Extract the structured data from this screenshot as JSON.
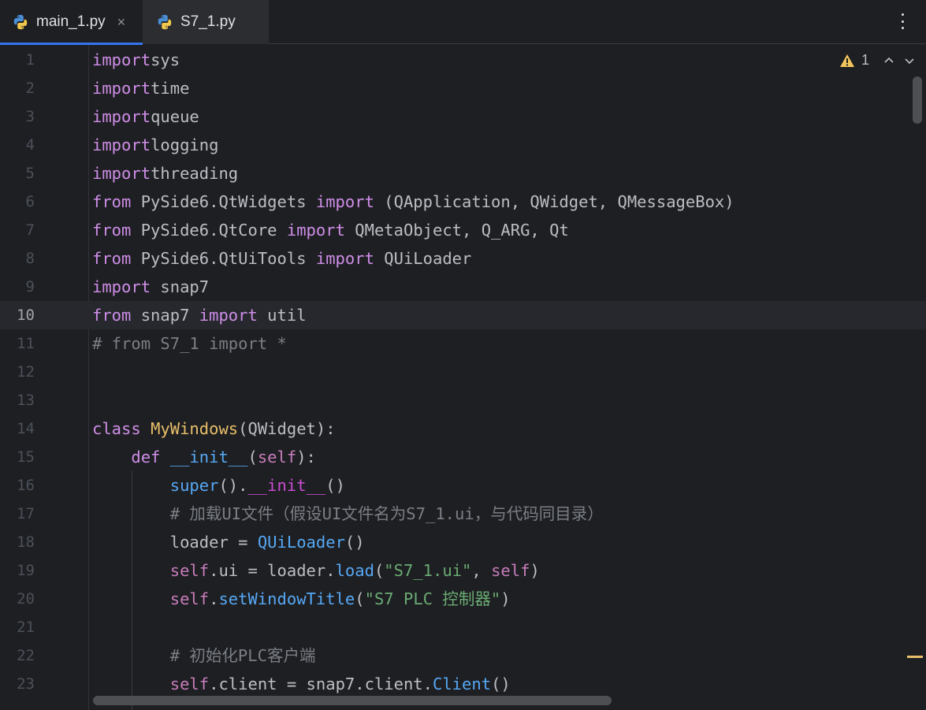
{
  "tabs": [
    {
      "label": "main_1.py",
      "icon": "python-icon",
      "active": true,
      "close": "×"
    },
    {
      "label": "S7_1.py",
      "icon": "python-icon",
      "active": false
    }
  ],
  "inspection": {
    "warnings": "1"
  },
  "current_line": 10,
  "colors": {
    "background": "#1e1f22",
    "keyword": "#cf8ee8",
    "class_name": "#e8bf6a",
    "function": "#56a8f5",
    "string": "#6aab73",
    "comment": "#7a7e85",
    "tab_accent": "#3574f0"
  },
  "code_lines": [
    [
      [
        "kw",
        "import"
      ],
      [
        "",
        "sys"
      ]
    ],
    [
      [
        "kw",
        "import"
      ],
      [
        "",
        "time"
      ]
    ],
    [
      [
        "kw",
        "import"
      ],
      [
        "",
        "queue"
      ]
    ],
    [
      [
        "kw",
        "import"
      ],
      [
        "",
        "logging"
      ]
    ],
    [
      [
        "kw",
        "import"
      ],
      [
        "",
        "threading"
      ]
    ],
    [
      [
        "kw",
        "from"
      ],
      [
        "",
        " PySide6.QtWidgets "
      ],
      [
        "kw",
        "import"
      ],
      [
        "",
        " (QApplication, QWidget, QMessageBox)"
      ]
    ],
    [
      [
        "kw",
        "from"
      ],
      [
        "",
        " PySide6.QtCore "
      ],
      [
        "kw",
        "import"
      ],
      [
        "",
        " QMetaObject, Q_ARG, Qt"
      ]
    ],
    [
      [
        "kw",
        "from"
      ],
      [
        "",
        " PySide6.QtUiTools "
      ],
      [
        "kw",
        "import"
      ],
      [
        "",
        " QUiLoader"
      ]
    ],
    [
      [
        "kw",
        "import"
      ],
      [
        "",
        " snap7"
      ]
    ],
    [
      [
        "kw",
        "from"
      ],
      [
        "",
        " snap7 "
      ],
      [
        "kw",
        "import"
      ],
      [
        "",
        " util"
      ]
    ],
    [
      [
        "cmt",
        "# from S7_1 import *"
      ]
    ],
    [],
    [],
    [
      [
        "kw",
        "class"
      ],
      [
        "",
        " "
      ],
      [
        "cls",
        "MyWindows"
      ],
      [
        "",
        "(QWidget):"
      ]
    ],
    [
      [
        "",
        "    "
      ],
      [
        "kw",
        "def"
      ],
      [
        "",
        " "
      ],
      [
        "fn",
        "__init__"
      ],
      [
        "",
        "("
      ],
      [
        "slf2",
        "self"
      ],
      [
        "",
        "):"
      ]
    ],
    [
      [
        "",
        "        "
      ],
      [
        "fn",
        "super"
      ],
      [
        "",
        "()."
      ],
      [
        "magic",
        "__init__"
      ],
      [
        "",
        "()"
      ]
    ],
    [
      [
        "",
        "        "
      ],
      [
        "cmt",
        "# 加载UI文件（假设UI文件名为S7_1.ui，与代码同目录）"
      ]
    ],
    [
      [
        "",
        "        loader = "
      ],
      [
        "fn",
        "QUiLoader"
      ],
      [
        "",
        "()"
      ]
    ],
    [
      [
        "",
        "        "
      ],
      [
        "slf2",
        "self"
      ],
      [
        "",
        ".ui = loader."
      ],
      [
        "fn",
        "load"
      ],
      [
        "",
        "("
      ],
      [
        "str",
        "\"S7_1.ui\""
      ],
      [
        "",
        ", "
      ],
      [
        "slf2",
        "self"
      ],
      [
        "",
        ")"
      ]
    ],
    [
      [
        "",
        "        "
      ],
      [
        "slf2",
        "self"
      ],
      [
        "",
        "."
      ],
      [
        "fn",
        "setWindowTitle"
      ],
      [
        "",
        "("
      ],
      [
        "str",
        "\"S7 PLC 控制器\""
      ],
      [
        "",
        ")"
      ]
    ],
    [],
    [
      [
        "",
        "        "
      ],
      [
        "cmt",
        "# 初始化PLC客户端"
      ]
    ],
    [
      [
        "",
        "        "
      ],
      [
        "slf2",
        "self"
      ],
      [
        "",
        ".client = snap7.client."
      ],
      [
        "fn",
        "Client"
      ],
      [
        "",
        "()"
      ]
    ]
  ]
}
